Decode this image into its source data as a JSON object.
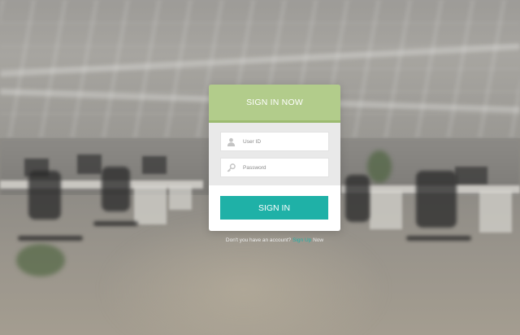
{
  "background": {
    "description_icon": "office-background"
  },
  "login": {
    "title": "SIGN IN NOW",
    "user_field": {
      "placeholder": "User ID",
      "value": "",
      "icon": "user-icon"
    },
    "password_field": {
      "placeholder": "Password",
      "value": "",
      "icon": "key-icon"
    },
    "submit_label": "SIGN IN",
    "signup_prefix": "Don't you have an account?",
    "signup_link": "Sign Up",
    "signup_suffix": "Now"
  },
  "colors": {
    "header": "#b2cc8b",
    "header_border": "#9cba70",
    "button": "#1fb1a7",
    "link": "#1fb1a7",
    "fields_panel": "#e9e9e9"
  }
}
